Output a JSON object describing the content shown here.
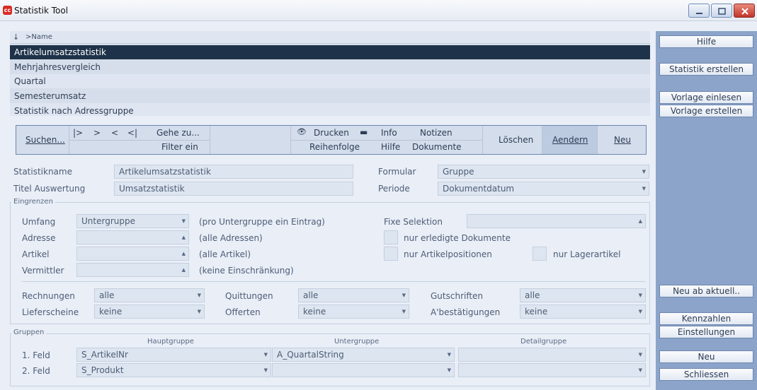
{
  "window": {
    "title": "Statistik Tool",
    "icon": "app-logo",
    "icon_text": "cc"
  },
  "list": {
    "sort_icon": "↓",
    "column": ">Name",
    "items": [
      "Artikelumsatzstatistik",
      "Mehrjahresvergleich",
      "Quartal",
      "Semesterumsatz",
      "Statistik nach Adressgruppe"
    ],
    "selected_index": 0
  },
  "toolbar": {
    "search": "Suchen...",
    "nav_first": "|>",
    "nav_next": ">",
    "nav_prev": "<",
    "nav_last": "<|",
    "goto": "Gehe zu...",
    "filter": "Filter ein",
    "print": "Drucken",
    "info": "Info",
    "notes": "Notizen",
    "order": "Reihenfolge",
    "help": "Hilfe",
    "documents": "Dokumente",
    "delete": "Löschen",
    "edit": "Aendern",
    "new": "Neu"
  },
  "form": {
    "name_label": "Statistikname",
    "name_value": "Artikelumsatzstatistik",
    "title_label": "Titel Auswertung",
    "title_value": "Umsatzstatistik",
    "formular_label": "Formular",
    "formular_value": "Gruppe",
    "periode_label": "Periode",
    "periode_value": "Dokumentdatum"
  },
  "eingrenzen": {
    "title": "Eingrenzen",
    "umfang_label": "Umfang",
    "umfang_value": "Untergruppe",
    "umfang_note": "(pro Untergruppe ein Eintrag)",
    "adresse_label": "Adresse",
    "adresse_note": "(alle Adressen)",
    "artikel_label": "Artikel",
    "artikel_note": "(alle Artikel)",
    "vermittler_label": "Vermittler",
    "vermittler_note": "(keine Einschränkung)",
    "fixe_label": "Fixe Selektion",
    "chk_erledigt": "nur erledigte Dokumente",
    "chk_artikelpos": "nur Artikelpositionen",
    "chk_lager": "nur Lagerartikel",
    "rechnungen_label": "Rechnungen",
    "rechnungen_value": "alle",
    "quittungen_label": "Quittungen",
    "quittungen_value": "alle",
    "gutschriften_label": "Gutschriften",
    "gutschriften_value": "alle",
    "lieferscheine_label": "Lieferscheine",
    "lieferscheine_value": "keine",
    "offerten_label": "Offerten",
    "offerten_value": "keine",
    "abest_label": "A'bestätigungen",
    "abest_value": "keine"
  },
  "gruppen": {
    "title": "Gruppen",
    "col_haupt": "Hauptgruppe",
    "col_unter": "Untergruppe",
    "col_detail": "Detailgruppe",
    "row1_label": "1. Feld",
    "row1_haupt": "S_ArtikelNr",
    "row1_unter": "A_QuartalString",
    "row2_label": "2. Feld",
    "row2_haupt": "S_Produkt"
  },
  "sidebar": {
    "hilfe": "Hilfe",
    "statistik_erstellen": "Statistik erstellen",
    "vorlage_einlesen": "Vorlage einlesen",
    "vorlage_erstellen": "Vorlage erstellen",
    "neu_ab_aktuell": "Neu ab aktuell..",
    "kennzahlen": "Kennzahlen",
    "einstellungen": "Einstellungen",
    "neu": "Neu",
    "schliessen": "Schliessen"
  }
}
